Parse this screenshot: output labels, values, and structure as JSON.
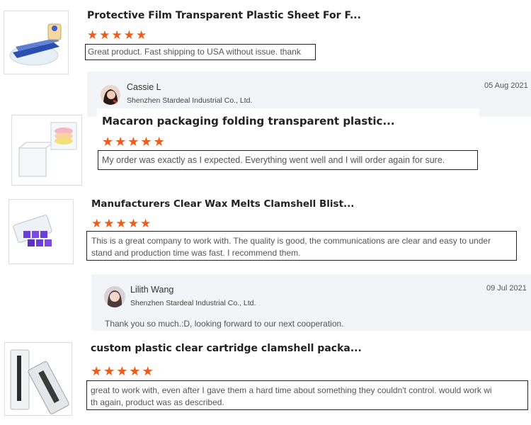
{
  "accent": "#f05a1a",
  "reviews": [
    {
      "product": "Protective Film Transparent Plastic Sheet For F...",
      "rating": 5,
      "comment": "Great product. Fast shipping to USA without issue. thank",
      "reply": {
        "name": "Cassie L",
        "company": "Shenzhen Stardeal Industrial Co., Ltd.",
        "date": "05 Aug 2021"
      }
    },
    {
      "product": "Macaron packaging folding transparent plastic...",
      "rating": 5,
      "comment": "My order was exactly as I expected. Everything went well and I will order again for sure."
    },
    {
      "product": "Manufacturers Clear Wax Melts Clamshell Blist...",
      "rating": 5,
      "comment_line1": "This is a great company to work with.  The quality is good, the communications are clear and easy to under",
      "comment_line2": "stand and production time was fast.  I recommend them.",
      "reply": {
        "name": "Lilith Wang",
        "company": "Shenzhen Stardeal Industrial Co., Ltd.",
        "date": "09 Jul 2021",
        "text": "Thank you so much.:D, looking forward to our next cooperation."
      }
    },
    {
      "product": "custom plastic clear cartridge clamshell packa...",
      "rating": 5,
      "comment_line1": "great to work with, even after I gave them a hard time about something they couldn't control. would work wi",
      "comment_line2": "th again, product was as described."
    }
  ]
}
